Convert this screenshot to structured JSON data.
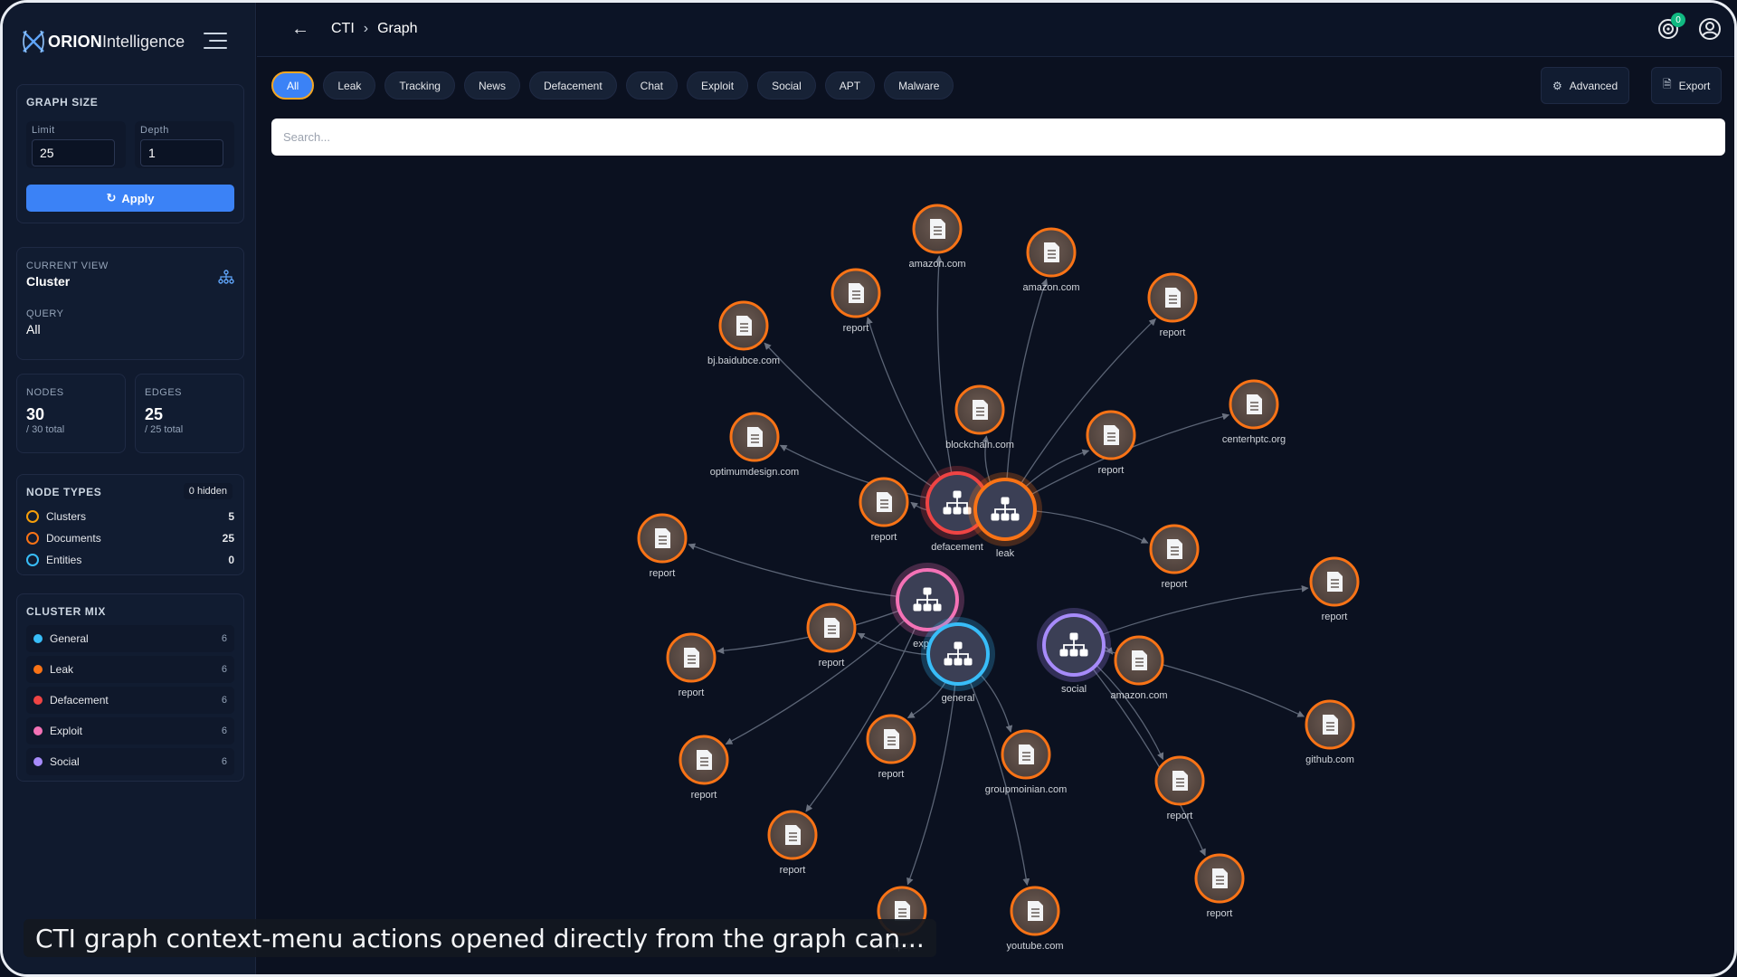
{
  "app": {
    "brand_bold": "ORION",
    "brand_rest": "Intelligence"
  },
  "header": {
    "crumbs": [
      "CTI",
      "Graph"
    ],
    "notifications": "0"
  },
  "filters": {
    "chips": [
      "All",
      "Leak",
      "Tracking",
      "News",
      "Defacement",
      "Chat",
      "Exploit",
      "Social",
      "APT",
      "Malware"
    ],
    "active": "All",
    "advanced_label": "Advanced",
    "export_label": "Export"
  },
  "search": {
    "placeholder": "Search..."
  },
  "graph_size": {
    "title": "GRAPH SIZE",
    "limit_label": "Limit",
    "limit_value": "25",
    "depth_label": "Depth",
    "depth_value": "1",
    "apply_label": "Apply"
  },
  "current_view": {
    "label": "CURRENT VIEW",
    "value": "Cluster",
    "query_label": "QUERY",
    "query_value": "All"
  },
  "stats": {
    "nodes_label": "NODES",
    "nodes_value": "30",
    "nodes_sub": "/ 30 total",
    "edges_label": "EDGES",
    "edges_value": "25",
    "edges_sub": "/ 25 total"
  },
  "node_types": {
    "title": "NODE TYPES",
    "hidden": "0 hidden",
    "items": [
      {
        "label": "Clusters",
        "count": "5",
        "color": "#f59e0b"
      },
      {
        "label": "Documents",
        "count": "25",
        "color": "#f97316"
      },
      {
        "label": "Entities",
        "count": "0",
        "color": "#38bdf8"
      }
    ]
  },
  "cluster_mix": {
    "title": "CLUSTER MIX",
    "items": [
      {
        "label": "General",
        "count": "6",
        "color": "#38bdf8"
      },
      {
        "label": "Leak",
        "count": "6",
        "color": "#f97316"
      },
      {
        "label": "Defacement",
        "count": "6",
        "color": "#ef4444"
      },
      {
        "label": "Exploit",
        "count": "6",
        "color": "#f472b6"
      },
      {
        "label": "Social",
        "count": "6",
        "color": "#a78bfa"
      }
    ]
  },
  "graph": {
    "clusters": [
      {
        "id": "defacement",
        "label": "defacement",
        "color": "#ef4444"
      },
      {
        "id": "leak",
        "label": "leak",
        "color": "#f97316"
      },
      {
        "id": "exploit",
        "label": "exploit",
        "color": "#f472b6"
      },
      {
        "id": "general",
        "label": "general",
        "color": "#38bdf8"
      },
      {
        "id": "social",
        "label": "social",
        "color": "#a78bfa"
      }
    ],
    "documents": [
      {
        "label": "amazon.com",
        "cluster": "defacement"
      },
      {
        "label": "amazon.com",
        "cluster": "leak"
      },
      {
        "label": "report",
        "cluster": "defacement"
      },
      {
        "label": "report",
        "cluster": "leak"
      },
      {
        "label": "bj.baidubce.com",
        "cluster": "defacement"
      },
      {
        "label": "blockchain.com",
        "cluster": "leak"
      },
      {
        "label": "centerhptc.org",
        "cluster": "leak"
      },
      {
        "label": "optimumdesign.com",
        "cluster": "defacement"
      },
      {
        "label": "report",
        "cluster": "leak"
      },
      {
        "label": "report",
        "cluster": "defacement"
      },
      {
        "label": "report",
        "cluster": "exploit"
      },
      {
        "label": "report",
        "cluster": "leak"
      },
      {
        "label": "report",
        "cluster": "social"
      },
      {
        "label": "report",
        "cluster": "general"
      },
      {
        "label": "report",
        "cluster": "exploit"
      },
      {
        "label": "amazon.com",
        "cluster": "social"
      },
      {
        "label": "github.com",
        "cluster": "social"
      },
      {
        "label": "report",
        "cluster": "exploit"
      },
      {
        "label": "report",
        "cluster": "general"
      },
      {
        "label": "groupmoinian.com",
        "cluster": "general"
      },
      {
        "label": "report",
        "cluster": "social"
      },
      {
        "label": "report",
        "cluster": "exploit"
      },
      {
        "label": "report",
        "cluster": "social"
      },
      {
        "label": "report",
        "cluster": "general"
      },
      {
        "label": "youtube.com",
        "cluster": "general"
      }
    ]
  },
  "caption": "CTI graph context-menu actions opened directly from the graph can..."
}
